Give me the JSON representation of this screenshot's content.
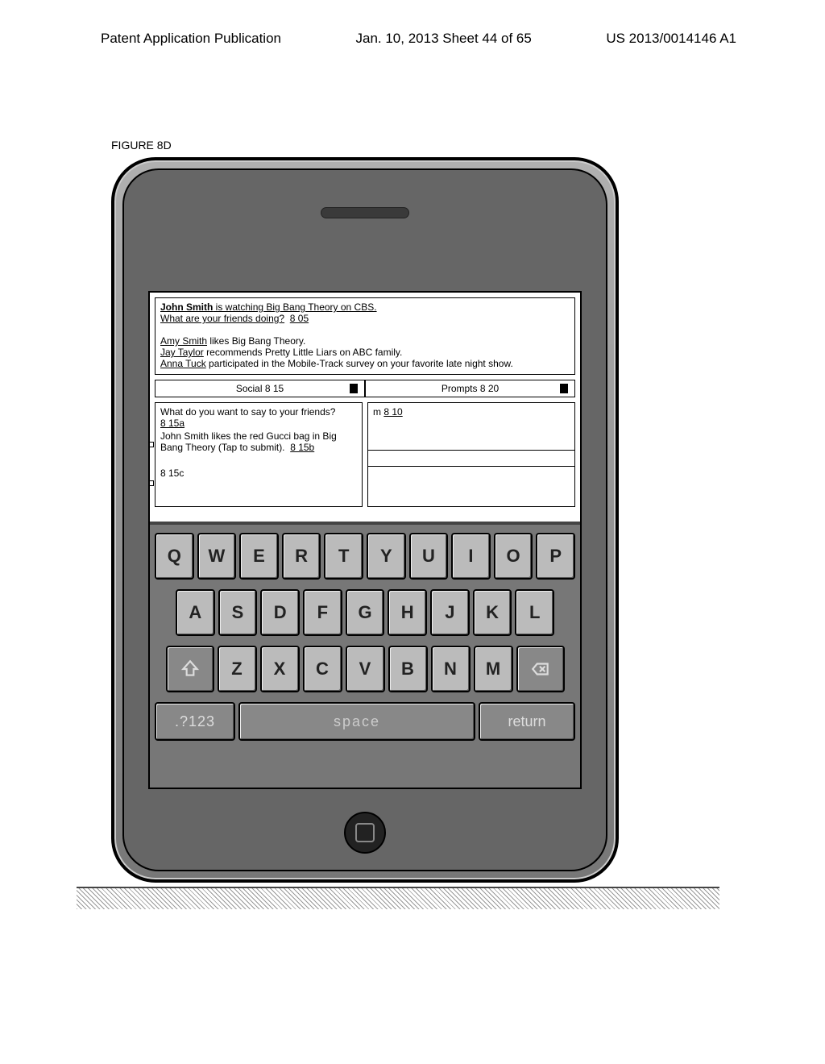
{
  "header": {
    "left": "Patent Application Publication",
    "center": "Jan. 10, 2013  Sheet 44 of 65",
    "right": "US 2013/0014146 A1"
  },
  "figure_label": "FIGURE 8D",
  "feed": {
    "status_name": "John Smith",
    "status_rest": " is watching Big Bang Theory on CBS.",
    "question": "What are your friends doing?",
    "question_ref": "8 05",
    "items": [
      {
        "name": "Amy Smith",
        "rest": " likes Big Bang Theory."
      },
      {
        "name": "Jay Taylor",
        "rest": " recommends Pretty Little Liars on ABC family."
      },
      {
        "name": "Anna Tuck",
        "rest": " participated in the Mobile-Track  survey on your favorite late night show."
      }
    ]
  },
  "tabs": {
    "left": "Social 8 15",
    "right": "Prompts 8 20"
  },
  "left_col": {
    "prompt": "What do you want to say to your friends?",
    "ref_a": "8 15a",
    "suggestion": "John Smith likes the red Gucci bag in Big Bang Theory (Tap to submit).",
    "ref_b": "8 15b",
    "ref_c": "8 15c"
  },
  "right_col": {
    "prefix": "m ",
    "ref": "8 10"
  },
  "keyboard": {
    "row1": [
      "Q",
      "W",
      "E",
      "R",
      "T",
      "Y",
      "U",
      "I",
      "O",
      "P"
    ],
    "row2": [
      "A",
      "S",
      "D",
      "F",
      "G",
      "H",
      "J",
      "K",
      "L"
    ],
    "row3": [
      "Z",
      "X",
      "C",
      "V",
      "B",
      "N",
      "M"
    ],
    "sym": ".?123",
    "space": "space",
    "ret": "return"
  }
}
